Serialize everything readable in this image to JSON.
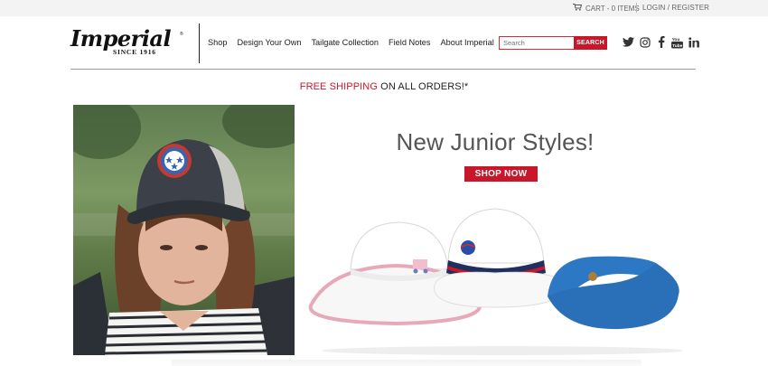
{
  "topbar": {
    "cart_label": "CART - 0 ITEMS",
    "login_label": "LOGIN / REGISTER"
  },
  "brand": {
    "logo_script": "Imperial",
    "logo_since": "SINCE 1916",
    "logo_reg": "®"
  },
  "nav": {
    "items": [
      {
        "label": "Shop"
      },
      {
        "label": "Design Your Own"
      },
      {
        "label": "Tailgate Collection"
      },
      {
        "label": "Field Notes"
      },
      {
        "label": "About Imperial"
      }
    ]
  },
  "search": {
    "placeholder": "Search",
    "button_label": "SEARCH"
  },
  "social": {
    "icons": [
      "twitter-icon",
      "instagram-icon",
      "facebook-icon",
      "youtube-icon",
      "linkedin-icon"
    ]
  },
  "promo": {
    "highlight": "FREE SHIPPING",
    "rest": " ON ALL ORDERS!*"
  },
  "hero": {
    "title": "New Junior Styles!",
    "cta_label": "SHOP NOW"
  },
  "colors": {
    "brand_red": "#c8172a",
    "topbar_bg": "#f3f3f3",
    "visor_blue": "#2c78c4"
  }
}
